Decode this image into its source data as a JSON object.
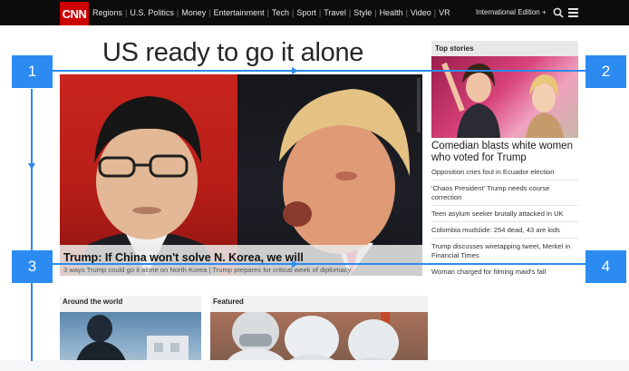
{
  "header": {
    "logo": "CNN",
    "nav": [
      "Regions",
      "U.S. Politics",
      "Money",
      "Entertainment",
      "Tech",
      "Sport",
      "Travel",
      "Style",
      "Health",
      "Video",
      "VR"
    ],
    "edition": "International Edition +"
  },
  "main": {
    "headline": "US ready to go it alone",
    "hero_caption": "Trump: If China won't solve N. Korea, we will",
    "hero_subtitle": "3 ways Trump could go it alone on North Korea | Trump prepares for critical week of diplomacy"
  },
  "sidebar": {
    "title": "Top stories",
    "top_headline": "Comedian blasts white women who voted for Trump",
    "stories": [
      "Opposition cries foul in Ecuador election",
      "'Chaos President' Trump needs course correction",
      "Teen asylum seeker brutally attacked in UK",
      "Colombia mudslide: 254 dead, 43 are kids",
      "Trump discusses wiretapping tweet, Merkel in Financial Times",
      "Woman charged for filming maid's fall"
    ]
  },
  "sections": {
    "world": "Around the world",
    "featured": "Featured"
  },
  "annotations": [
    "1",
    "2",
    "3",
    "4"
  ],
  "colors": {
    "brand_red": "#cc0000",
    "annotation_blue": "#2b8bf0",
    "topbar": "#0c0c0c"
  }
}
